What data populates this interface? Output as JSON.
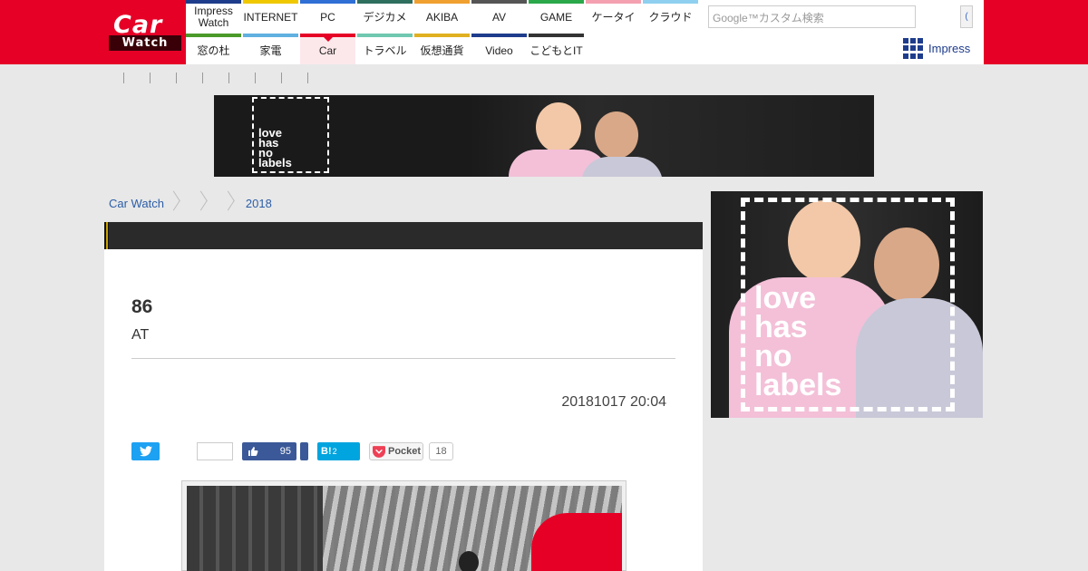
{
  "logo": {
    "line1": "Car",
    "line2": "Watch"
  },
  "nav": {
    "row1": [
      {
        "label": "Impress Watch",
        "color": "#1e3c8c"
      },
      {
        "label": "INTERNET",
        "color": "#f0c800"
      },
      {
        "label": "PC",
        "color": "#2f6fd6"
      },
      {
        "label": "デジカメ",
        "color": "#2f6f5e"
      },
      {
        "label": "AKIBA",
        "color": "#f0a030"
      },
      {
        "label": "AV",
        "color": "#555555"
      },
      {
        "label": "GAME",
        "color": "#2aa84a"
      },
      {
        "label": "ケータイ",
        "color": "#f4a0b0"
      },
      {
        "label": "クラウド",
        "color": "#8fd0f0"
      }
    ],
    "row2": [
      {
        "label": "窓の杜",
        "color": "#4a9a2a"
      },
      {
        "label": "家電",
        "color": "#60b0e0"
      },
      {
        "label": "Car",
        "color": "#e60026",
        "active": true
      },
      {
        "label": "トラベル",
        "color": "#70c8b0"
      },
      {
        "label": "仮想通貨",
        "color": "#e0b020"
      },
      {
        "label": "Video",
        "color": "#1e3c8c"
      },
      {
        "label": "こどもとIT",
        "color": "#333333"
      }
    ]
  },
  "search": {
    "placeholder": "Google™カスタム検索",
    "button": "("
  },
  "impress": {
    "label": "Impress"
  },
  "ad": {
    "text": "love has no labels"
  },
  "breadcrumb": {
    "home": "Car Watch",
    "year": "2018"
  },
  "article": {
    "title": "86",
    "subtitle": "AT",
    "date": "20181017 20:04"
  },
  "share": {
    "like_count": "95",
    "hatena_label": "B!",
    "hatena_count": "2",
    "pocket_label": "Pocket",
    "pocket_count": "18"
  },
  "colors": {
    "brand": "#e60026",
    "link": "#2c5ea8",
    "facebook": "#3b5998",
    "twitter": "#1da1f2",
    "hatena": "#00a4de"
  }
}
